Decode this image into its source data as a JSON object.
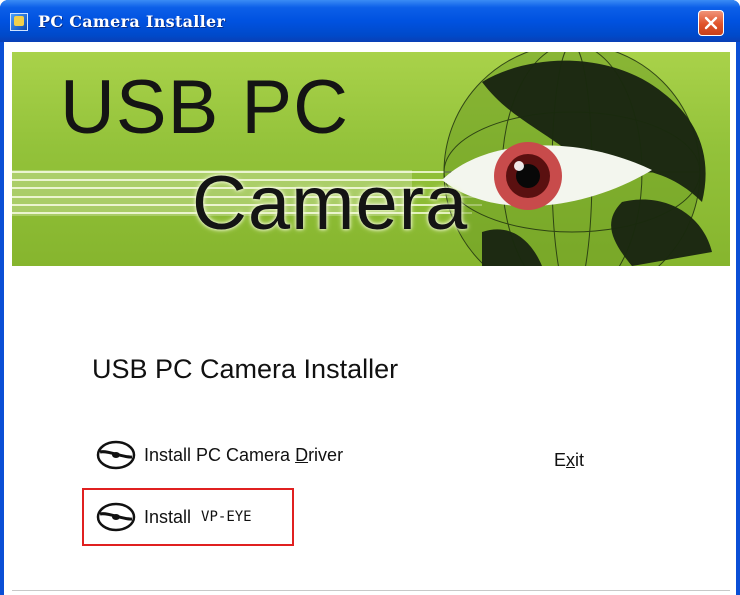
{
  "window": {
    "title": "PC Camera Installer",
    "close_icon": "close-icon",
    "accent": "#0a4fd6",
    "close_color": "#e0532a"
  },
  "banner": {
    "line1": "USB PC",
    "line2": "Camera",
    "background": "#93c23a",
    "image": "globe-with-eye"
  },
  "main": {
    "heading": "USB PC Camera Installer",
    "options": [
      {
        "icon": "cd-disc-icon",
        "label_prefix": "Install PC Camera ",
        "label_mnemonic": "D",
        "label_suffix": "river"
      },
      {
        "icon": "cd-disc-icon",
        "label": "Install",
        "label_product": "VP-EYE",
        "highlight_color": "#e02020"
      }
    ],
    "exit": {
      "prefix": "E",
      "mnemonic": "x",
      "suffix": "it"
    }
  }
}
